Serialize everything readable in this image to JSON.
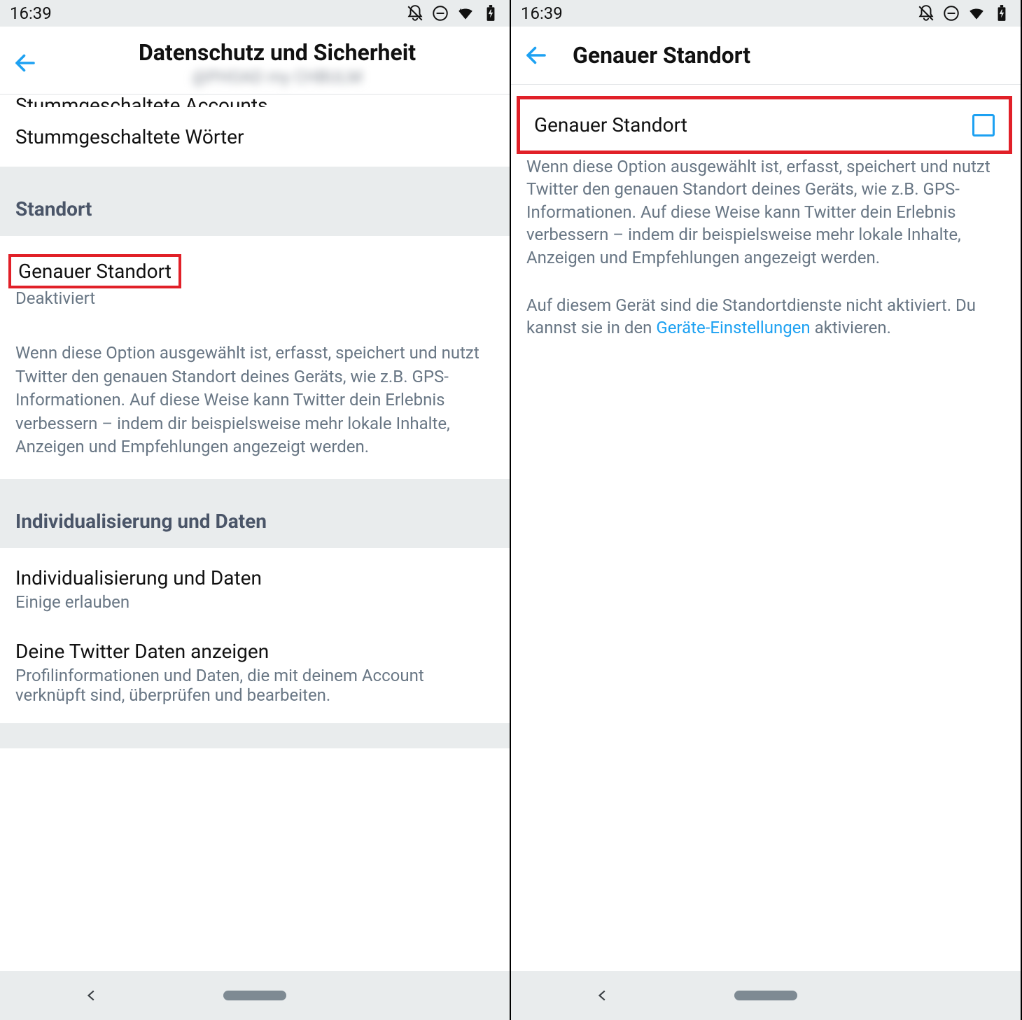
{
  "statusbar": {
    "time": "16:39"
  },
  "left": {
    "header": {
      "title": "Datenschutz und Sicherheit",
      "subtitle": "@PHOAD my CHBULM"
    },
    "partial_item": "Stummgeschaltete Accounts",
    "muted_words": "Stummgeschaltete Wörter",
    "section_location": "Standort",
    "precise_location": {
      "label": "Genauer Standort",
      "status": "Deaktiviert",
      "description": "Wenn diese Option ausgewählt ist, erfasst, speichert und nutzt Twitter den genauen Standort deines Geräts, wie z.B. GPS-Informationen. Auf diese Weise kann Twitter dein Erlebnis verbessern – indem dir beispielsweise mehr lokale Inhalte, Anzeigen und Empfehlungen angezeigt werden."
    },
    "section_personalization": "Individualisierung und Daten",
    "personalization": {
      "label": "Individualisierung und Daten",
      "status": "Einige erlauben"
    },
    "twitter_data": {
      "label": "Deine Twitter Daten anzeigen",
      "desc": "Profilinformationen und Daten, die mit deinem Account verknüpft sind, überprüfen und bearbeiten."
    }
  },
  "right": {
    "header_title": "Genauer Standort",
    "checkbox_label": "Genauer Standort",
    "desc1": "Wenn diese Option ausgewählt ist, erfasst, speichert und nutzt Twitter den genauen Standort deines Geräts, wie z.B. GPS-Informationen. Auf diese Weise kann Twitter dein Erlebnis verbessern – indem dir beispielsweise mehr lokale Inhalte, Anzeigen und Empfehlungen angezeigt werden.",
    "desc2_pre": "Auf diesem Gerät sind die Standortdienste nicht aktiviert. Du kannst sie in den ",
    "desc2_link": "Geräte-Einstellungen",
    "desc2_post": " aktivieren."
  }
}
